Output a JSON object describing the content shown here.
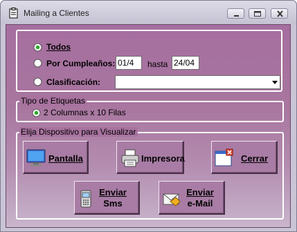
{
  "window": {
    "title": "Mailing a Clientes"
  },
  "filter": {
    "todos_label": "Todos",
    "cumple_label": "Por Cumpleaños:",
    "cumple_from": "01/4",
    "hasta_label": "hasta",
    "cumple_to": "24/04",
    "clasif_label": "Clasificación:",
    "clasif_value": ""
  },
  "labels_group": {
    "legend": "Tipo de Etiquetas",
    "option_label": "2 Columnas x 10 Filas"
  },
  "device_group": {
    "legend": "Elija Dispositivo para Visualizar",
    "pantalla": "Pantalla",
    "impresora": "Impresora",
    "cerrar": "Cerrar",
    "sms_line1": "Enviar",
    "sms_line2": "Sms",
    "email_line1": "Enviar",
    "email_line2": "e-Mail"
  },
  "icons": {
    "app": "clipboard-icon",
    "minimize": "minimize-icon",
    "maximize": "maximize-icon",
    "close": "close-icon",
    "pantalla": "monitor-icon",
    "impresora": "printer-icon",
    "cerrar": "close-window-icon",
    "sms": "phone-icon",
    "email": "envelope-icon"
  }
}
